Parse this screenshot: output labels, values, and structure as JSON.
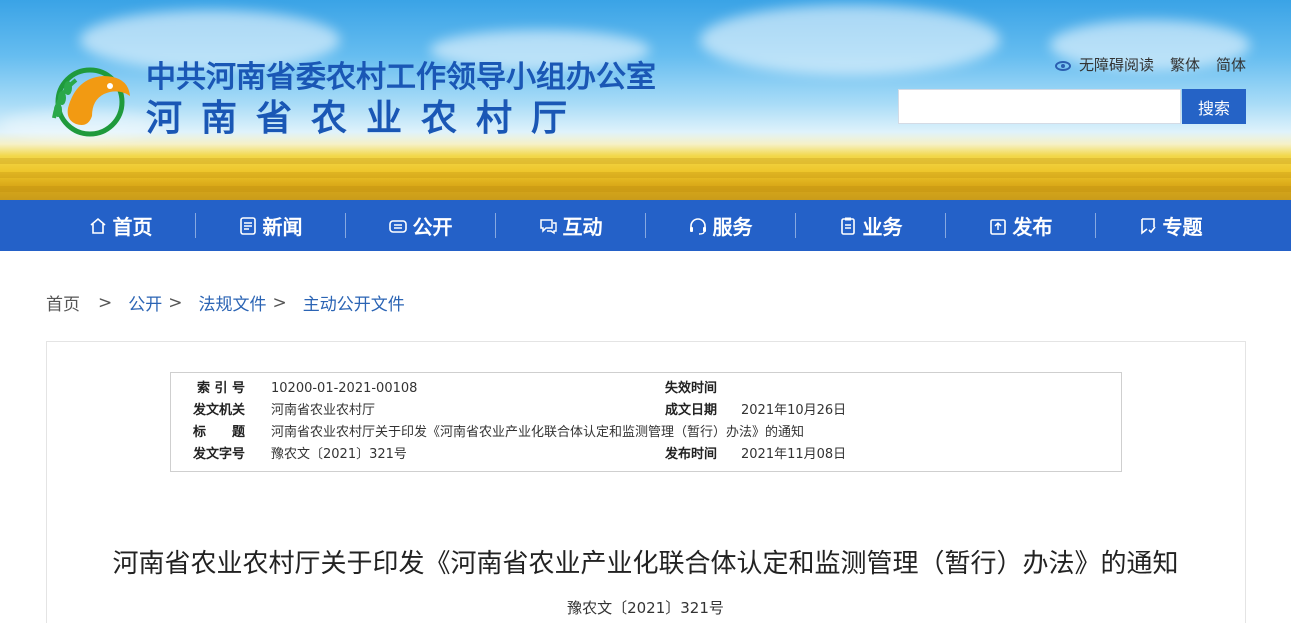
{
  "header": {
    "org_line1": "中共河南省委农村工作领导小组办公室",
    "org_line2": "河南省农业农村厅",
    "accessibility_label": "无障碍阅读",
    "traditional_label": "繁体",
    "simplified_label": "简体",
    "search_button": "搜索",
    "search_value": ""
  },
  "nav": {
    "items": [
      {
        "label": "首页",
        "icon": "home-icon"
      },
      {
        "label": "新闻",
        "icon": "news-icon"
      },
      {
        "label": "公开",
        "icon": "open-icon"
      },
      {
        "label": "互动",
        "icon": "chat-icon"
      },
      {
        "label": "服务",
        "icon": "headset-icon"
      },
      {
        "label": "业务",
        "icon": "clipboard-icon"
      },
      {
        "label": "发布",
        "icon": "publish-icon"
      },
      {
        "label": "专题",
        "icon": "bookmark-icon"
      }
    ]
  },
  "breadcrumb": {
    "home": "首页",
    "sep": ">",
    "items": [
      "公开",
      "法规文件",
      "主动公开文件"
    ]
  },
  "meta": {
    "index_label": "索 引 号",
    "index_value": "10200-01-2021-00108",
    "expire_label": "失效时间",
    "expire_value": "",
    "issuer_label": "发文机关",
    "issuer_value": "河南省农业农村厅",
    "created_label": "成文日期",
    "created_value": "2021年10月26日",
    "title_label": "标　　题",
    "title_value": "河南省农业农村厅关于印发《河南省农业产业化联合体认定和监测管理（暂行）办法》的通知",
    "docno_label": "发文字号",
    "docno_value": "豫农文〔2021〕321号",
    "published_label": "发布时间",
    "published_value": "2021年11月08日"
  },
  "document": {
    "title": "河南省农业农村厅关于印发《河南省农业产业化联合体认定和监测管理（暂行）办法》的通知",
    "number": "豫农文〔2021〕321号"
  },
  "colors": {
    "nav_bg": "#2461c8",
    "brand_blue": "#1a57b5",
    "link_blue": "#2b64b4",
    "search_button": "#2563c6"
  }
}
